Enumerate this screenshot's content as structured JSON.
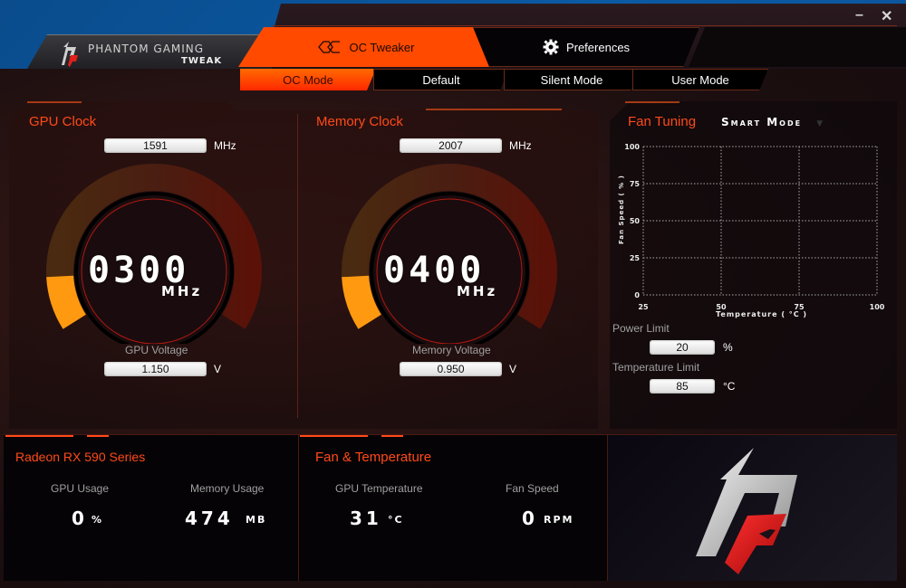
{
  "app": {
    "brand_line1": "PHANTOM GAMING",
    "brand_line2": "TWEAK",
    "minimize_label": "–",
    "close_label": "✕"
  },
  "main_tabs": [
    {
      "label": "OC Tweaker",
      "icon": "oc-icon",
      "active": true
    },
    {
      "label": "Preferences",
      "icon": "gear-icon",
      "active": false
    }
  ],
  "mode_tabs": [
    {
      "label": "OC Mode",
      "active": true
    },
    {
      "label": "Default",
      "active": false
    },
    {
      "label": "Silent Mode",
      "active": false
    },
    {
      "label": "User Mode",
      "active": false
    }
  ],
  "gpu_clock": {
    "title": "GPU Clock",
    "input_value": "1591",
    "input_unit": "MHz",
    "gauge_value": "0300",
    "gauge_unit": "MHz",
    "gauge_fraction": 0.12,
    "voltage_label": "GPU Voltage",
    "voltage_value": "1.150",
    "voltage_unit": "V"
  },
  "memory_clock": {
    "title": "Memory Clock",
    "input_value": "2007",
    "input_unit": "MHz",
    "gauge_value": "0400",
    "gauge_unit": "MHz",
    "gauge_fraction": 0.12,
    "voltage_label": "Memory Voltage",
    "voltage_value": "0.950",
    "voltage_unit": "V"
  },
  "fan_tuning": {
    "title": "Fan Tuning",
    "mode": "Smart Mode",
    "chart": {
      "ylabel": "Fan Speed ( % )",
      "xlabel": "Temperature ( °C )",
      "y_ticks": [
        "100",
        "75",
        "50",
        "25",
        "0"
      ],
      "x_ticks": [
        "25",
        "50",
        "75",
        "100"
      ]
    },
    "power_limit_label": "Power Limit",
    "power_limit_value": "20",
    "power_limit_unit": "%",
    "temp_limit_label": "Temperature Limit",
    "temp_limit_value": "85",
    "temp_limit_unit": "°C"
  },
  "gpu_info": {
    "title": "Radeon RX 590 Series",
    "gpu_usage_label": "GPU Usage",
    "gpu_usage_value": "0",
    "gpu_usage_unit": "%",
    "memory_usage_label": "Memory Usage",
    "memory_usage_value": "474",
    "memory_usage_unit": "MB"
  },
  "fan_temp": {
    "title": "Fan & Temperature",
    "gpu_temp_label": "GPU Temperature",
    "gpu_temp_value": "31",
    "gpu_temp_unit": "°C",
    "fan_speed_label": "Fan Speed",
    "fan_speed_value": "0",
    "fan_speed_unit": "RPM"
  },
  "colors": {
    "accent": "#ff4a00",
    "title_red": "#ff4a1a",
    "gauge_active": "#ff9a10"
  }
}
